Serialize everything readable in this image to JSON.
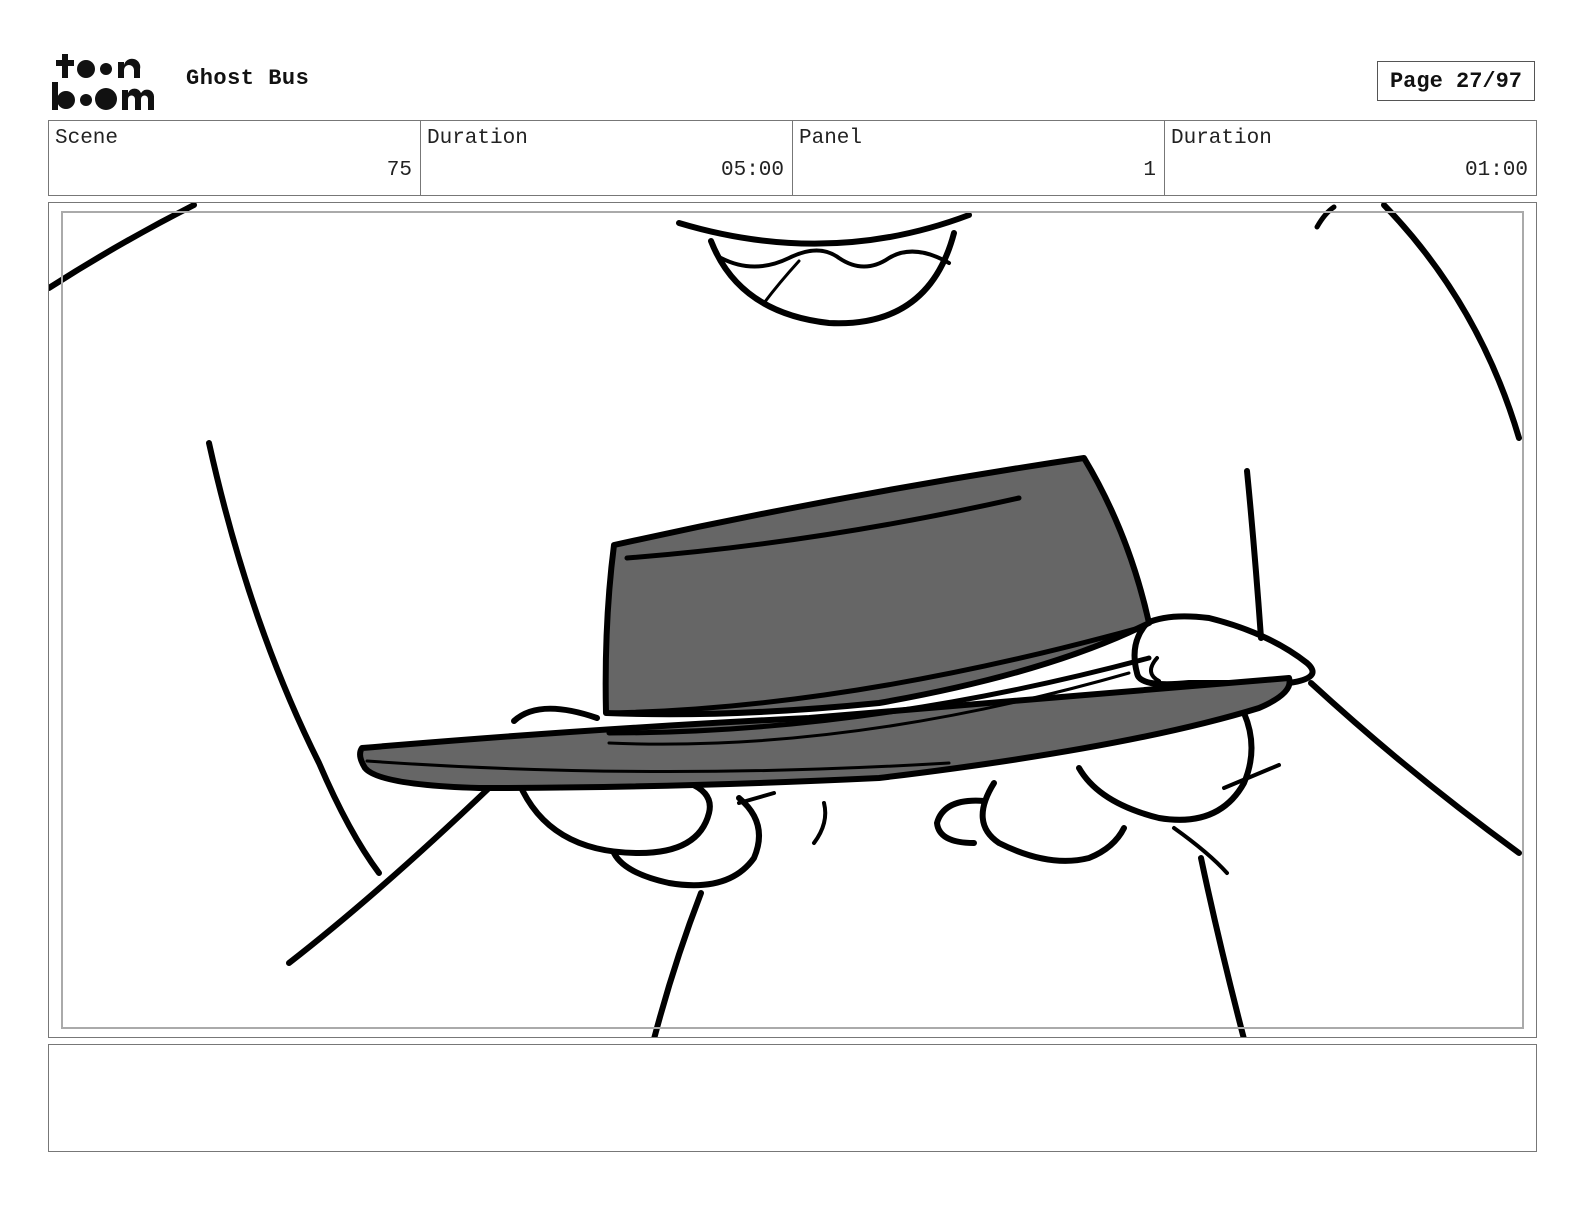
{
  "header": {
    "logo_text": "toon boom",
    "project_title": "Ghost Bus",
    "page_label": "Page 27/97"
  },
  "info": {
    "scene_label": "Scene",
    "scene_value": "75",
    "scene_duration_label": "Duration",
    "scene_duration_value": "05:00",
    "panel_label": "Panel",
    "panel_value": "1",
    "panel_duration_label": "Duration",
    "panel_duration_value": "01:00"
  },
  "panel": {
    "description": "",
    "hat_color": "#666666",
    "line_color": "#000000"
  },
  "notes": {
    "text": ""
  }
}
